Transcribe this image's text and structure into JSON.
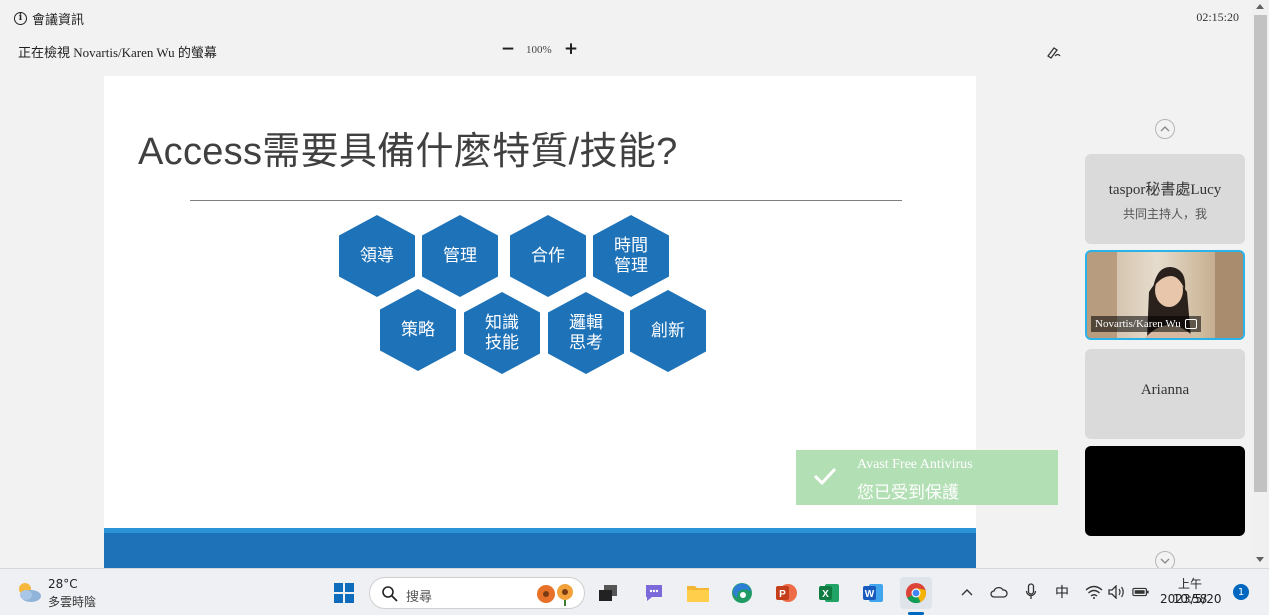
{
  "meeting": {
    "info_label": "會議資訊",
    "elapsed": "02:15:20",
    "viewing_label": "正在檢視 Novartis/Karen Wu 的螢幕",
    "zoom_minus": "−",
    "zoom_level": "100%",
    "zoom_plus": "+"
  },
  "slide": {
    "title": "Access需要具備什麼特質/技能?",
    "hexagons": [
      "領導",
      "管理",
      "合作",
      "時間\n管理",
      "策略",
      "知識\n技能",
      "邏輯\n思考",
      "創新"
    ]
  },
  "toast": {
    "title": "Avast Free Antivirus",
    "message": "您已受到保護"
  },
  "participants": [
    {
      "name": "taspor秘書處Lucy",
      "role": "共同主持人，我"
    },
    {
      "name": "Novartis/Karen Wu"
    },
    {
      "name": "Arianna"
    },
    {
      "name": ""
    }
  ],
  "taskbar": {
    "temperature": "28°C",
    "condition": "多雲時陰",
    "search_placeholder": "搜尋",
    "ime": "中",
    "time": "上午 10:58",
    "date": "2023/5/20",
    "notification_count": "1"
  },
  "colors": {
    "slide_blue": "#1e72b8",
    "toast_green": "#b3dfb5",
    "active_tile_border": "#2ab3e8"
  }
}
